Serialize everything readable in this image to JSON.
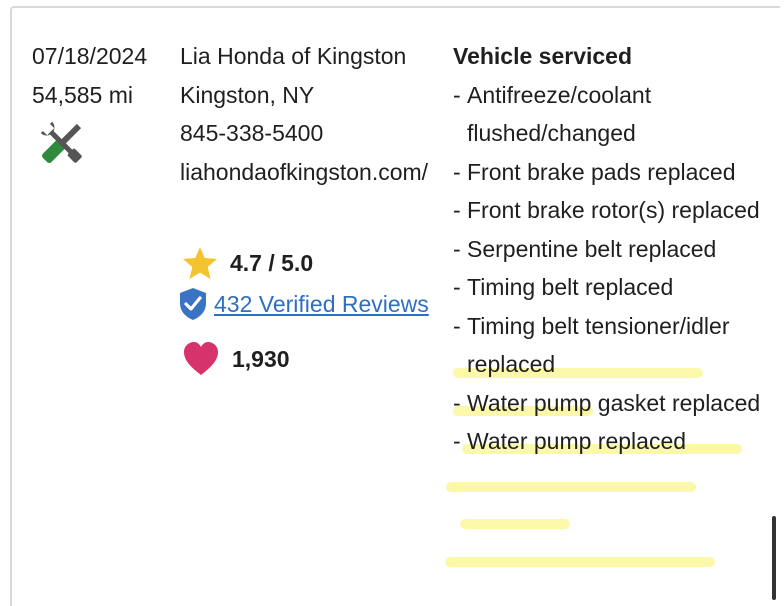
{
  "record": {
    "date": "07/18/2024",
    "mileage": "54,585 mi",
    "icon": "tools-icon"
  },
  "dealer": {
    "name": "Lia Honda of Kingston",
    "location": "Kingston, NY",
    "phone": "845-338-5400",
    "website": "liahondaofkingston.com/",
    "rating": "4.7 / 5.0",
    "reviews_link": "432 Verified Reviews",
    "likes": "1,930"
  },
  "services": {
    "title": "Vehicle serviced",
    "items": [
      {
        "text": "Antifreeze/coolant flushed/changed",
        "highlighted": false
      },
      {
        "text": "Front brake pads replaced",
        "highlighted": false
      },
      {
        "text": "Front brake rotor(s) replaced",
        "highlighted": false
      },
      {
        "text": "Serpentine belt replaced",
        "highlighted": false
      },
      {
        "text": "Timing belt replaced",
        "highlighted": true
      },
      {
        "text": "Timing belt tensioner/idler replaced",
        "highlighted": true
      },
      {
        "text": "Water pump gasket replaced",
        "highlighted": true
      },
      {
        "text": "Water pump replaced",
        "highlighted": true
      }
    ]
  },
  "colors": {
    "link": "#2f6fbf",
    "star": "#f4c430",
    "shield": "#3b73c4",
    "heart": "#d6336c",
    "wrench_green": "#2e8b3e",
    "highlight": "#fbf79a"
  }
}
